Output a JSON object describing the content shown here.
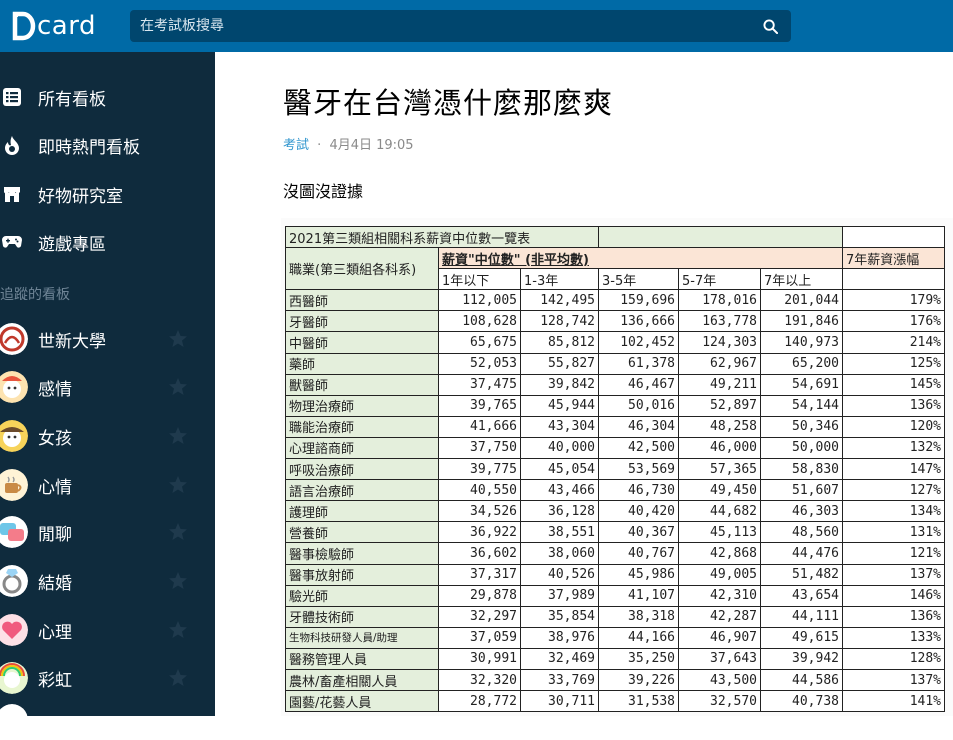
{
  "header": {
    "logo_text": "card",
    "search_placeholder": "在考試板搜尋"
  },
  "sidebar": {
    "nav": [
      {
        "label": "所有看板",
        "icon": "list-icon"
      },
      {
        "label": "即時熱門看板",
        "icon": "flame-icon"
      },
      {
        "label": "好物研究室",
        "icon": "shop-icon"
      },
      {
        "label": "遊戲專區",
        "icon": "gamepad-icon"
      }
    ],
    "section_title": "追蹤的看板",
    "boards": [
      {
        "label": "世新大學"
      },
      {
        "label": "感情"
      },
      {
        "label": "女孩"
      },
      {
        "label": "心情"
      },
      {
        "label": "閒聊"
      },
      {
        "label": "結婚"
      },
      {
        "label": "心理"
      },
      {
        "label": "彩虹"
      }
    ]
  },
  "post": {
    "title": "醫牙在台灣憑什麼那麼爽",
    "forum": "考試",
    "separator": "·",
    "date": "4月4日 19:05",
    "body": "沒圖沒證據"
  },
  "table": {
    "title": "2021第三類組相關科系薪資中位數一覽表",
    "job_header": "職業(第三類組各科系)",
    "median_header": "薪資\"中位數\" (非平均數)",
    "growth_header": "7年薪資漲幅",
    "year_headers": [
      "1年以下",
      "1-3年",
      "3-5年",
      "5-7年",
      "7年以上"
    ],
    "rows": [
      {
        "job": "西醫師",
        "values": [
          "112,005",
          "142,495",
          "159,696",
          "178,016",
          "201,044"
        ],
        "growth": "179%"
      },
      {
        "job": "牙醫師",
        "values": [
          "108,628",
          "128,742",
          "136,666",
          "163,778",
          "191,846"
        ],
        "growth": "176%"
      },
      {
        "job": "中醫師",
        "values": [
          "65,675",
          "85,812",
          "102,452",
          "124,303",
          "140,973"
        ],
        "growth": "214%"
      },
      {
        "job": "藥師",
        "values": [
          "52,053",
          "55,827",
          "61,378",
          "62,967",
          "65,200"
        ],
        "growth": "125%"
      },
      {
        "job": "獸醫師",
        "values": [
          "37,475",
          "39,842",
          "46,467",
          "49,211",
          "54,691"
        ],
        "growth": "145%"
      },
      {
        "job": "物理治療師",
        "values": [
          "39,765",
          "45,944",
          "50,016",
          "52,897",
          "54,144"
        ],
        "growth": "136%"
      },
      {
        "job": "職能治療師",
        "values": [
          "41,666",
          "43,304",
          "46,304",
          "48,258",
          "50,346"
        ],
        "growth": "120%"
      },
      {
        "job": "心理諮商師",
        "values": [
          "37,750",
          "40,000",
          "42,500",
          "46,000",
          "50,000"
        ],
        "growth": "132%"
      },
      {
        "job": "呼吸治療師",
        "values": [
          "39,775",
          "45,054",
          "53,569",
          "57,365",
          "58,830"
        ],
        "growth": "147%"
      },
      {
        "job": "語言治療師",
        "values": [
          "40,550",
          "43,466",
          "46,730",
          "49,450",
          "51,607"
        ],
        "growth": "127%"
      },
      {
        "job": "護理師",
        "values": [
          "34,526",
          "36,128",
          "40,420",
          "44,682",
          "46,303"
        ],
        "growth": "134%"
      },
      {
        "job": "營養師",
        "values": [
          "36,922",
          "38,551",
          "40,367",
          "45,113",
          "48,560"
        ],
        "growth": "131%"
      },
      {
        "job": "醫事檢驗師",
        "values": [
          "36,602",
          "38,060",
          "40,767",
          "42,868",
          "44,476"
        ],
        "growth": "121%"
      },
      {
        "job": "醫事放射師",
        "values": [
          "37,317",
          "40,526",
          "45,986",
          "49,005",
          "51,482"
        ],
        "growth": "137%"
      },
      {
        "job": "驗光師",
        "values": [
          "29,878",
          "37,989",
          "41,107",
          "42,310",
          "43,654"
        ],
        "growth": "146%"
      },
      {
        "job": "牙體技術師",
        "values": [
          "32,297",
          "35,854",
          "38,318",
          "42,287",
          "44,111"
        ],
        "growth": "136%"
      },
      {
        "job": "生物科技研發人員/助理",
        "values": [
          "37,059",
          "38,976",
          "44,166",
          "46,907",
          "49,615"
        ],
        "growth": "133%"
      },
      {
        "job": "醫務管理人員",
        "values": [
          "30,991",
          "32,469",
          "35,250",
          "37,643",
          "39,942"
        ],
        "growth": "128%"
      },
      {
        "job": "農林/畜產相關人員",
        "values": [
          "32,320",
          "33,769",
          "39,226",
          "43,500",
          "44,586"
        ],
        "growth": "137%"
      },
      {
        "job": "園藝/花藝人員",
        "values": [
          "28,772",
          "30,711",
          "31,538",
          "32,570",
          "40,738"
        ],
        "growth": "141%"
      }
    ]
  },
  "colors": {
    "header_bg": "#006aa6",
    "search_bg": "#00466e",
    "sidebar_bg": "#0f2b3d",
    "accent_link": "#3397cf",
    "table_green": "#e4efdc",
    "table_peach": "#fbe5d6"
  }
}
